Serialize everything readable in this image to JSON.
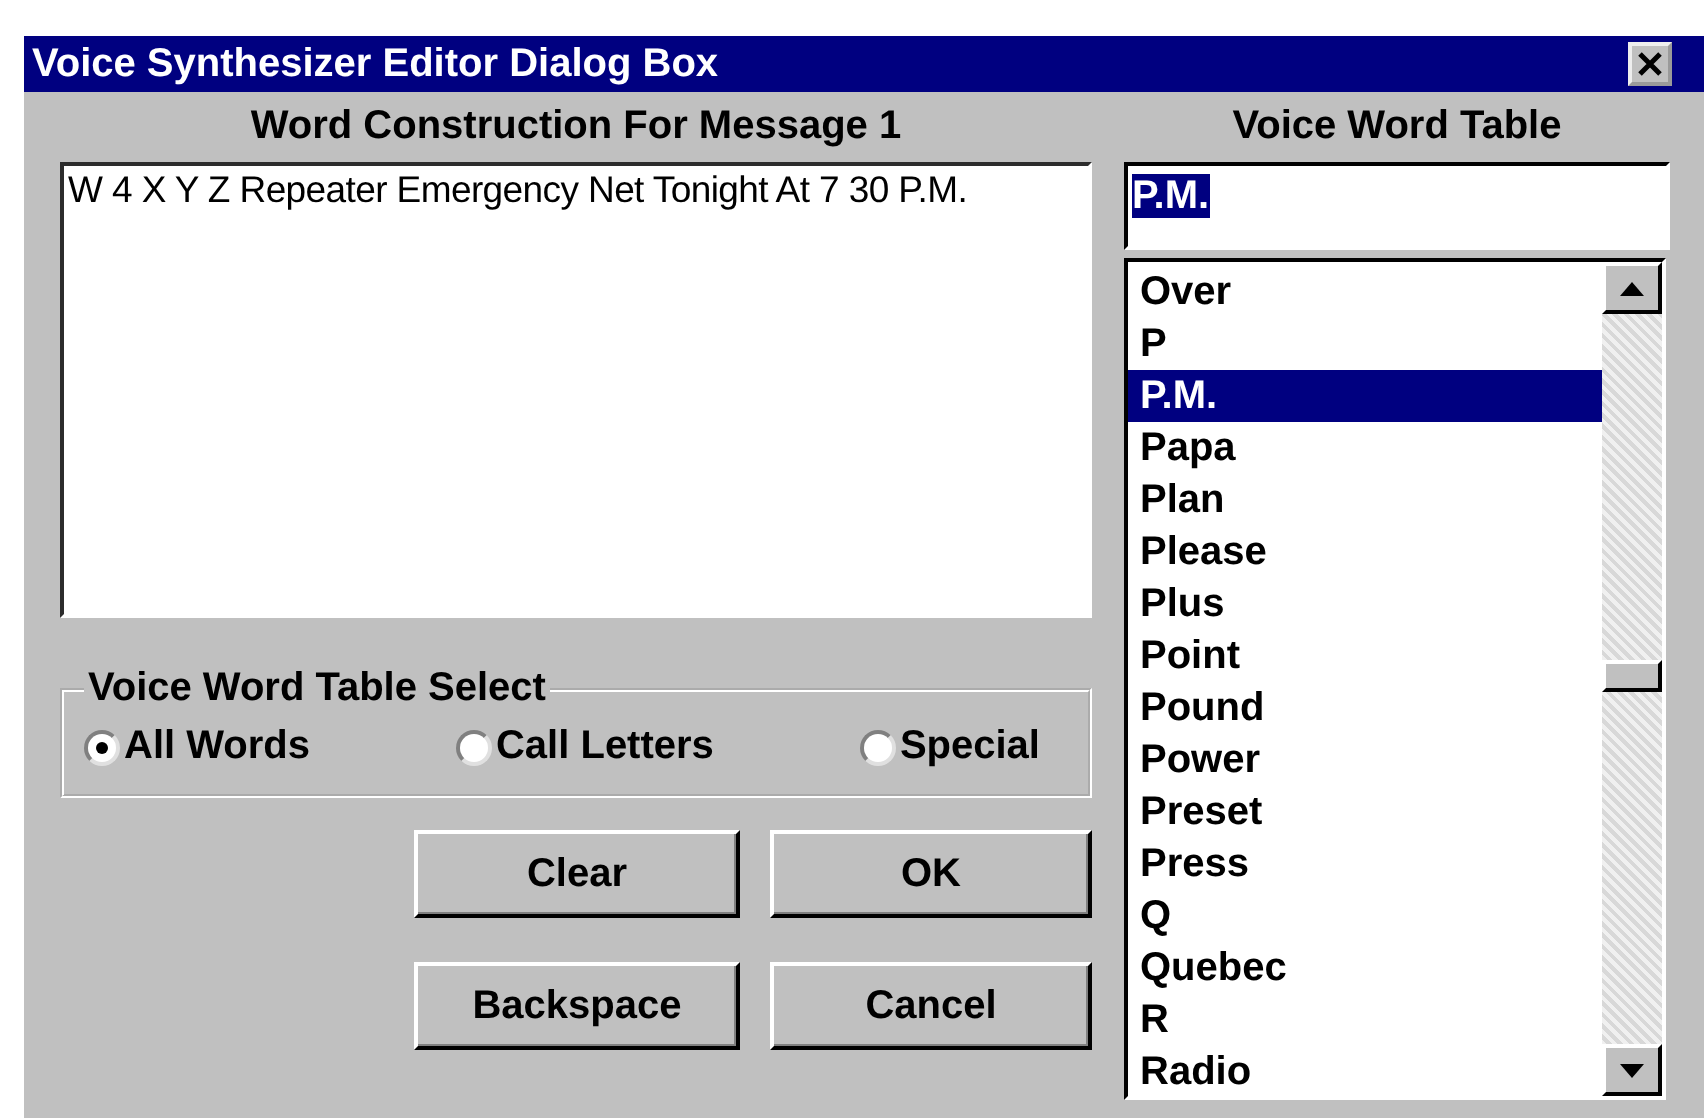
{
  "window": {
    "title": "Voice Synthesizer Editor Dialog Box"
  },
  "message": {
    "label": "Word Construction For Message 1",
    "value": "W 4 X Y Z Repeater Emergency Net Tonight At 7 30 P.M."
  },
  "table_select": {
    "label": "Voice Word Table Select",
    "options": [
      {
        "label": "All Words",
        "selected": true
      },
      {
        "label": "Call Letters",
        "selected": false
      },
      {
        "label": "Special",
        "selected": false
      }
    ]
  },
  "buttons": [
    {
      "label": "Clear"
    },
    {
      "label": "OK"
    },
    {
      "label": "Backspace"
    },
    {
      "label": "Cancel"
    }
  ],
  "word_table": {
    "label": "Voice Word Table",
    "field": {
      "value": "P.M.",
      "selected": true
    },
    "items": [
      {
        "label": "Over",
        "selected": false
      },
      {
        "label": "P",
        "selected": false
      },
      {
        "label": "P.M.",
        "selected": true
      },
      {
        "label": "Papa",
        "selected": false
      },
      {
        "label": "Plan",
        "selected": false
      },
      {
        "label": "Please",
        "selected": false
      },
      {
        "label": "Plus",
        "selected": false
      },
      {
        "label": "Point",
        "selected": false
      },
      {
        "label": "Pound",
        "selected": false
      },
      {
        "label": "Power",
        "selected": false
      },
      {
        "label": "Preset",
        "selected": false
      },
      {
        "label": "Press",
        "selected": false
      },
      {
        "label": "Q",
        "selected": false
      },
      {
        "label": "Quebec",
        "selected": false
      },
      {
        "label": "R",
        "selected": false
      },
      {
        "label": "Radio",
        "selected": false
      }
    ]
  }
}
